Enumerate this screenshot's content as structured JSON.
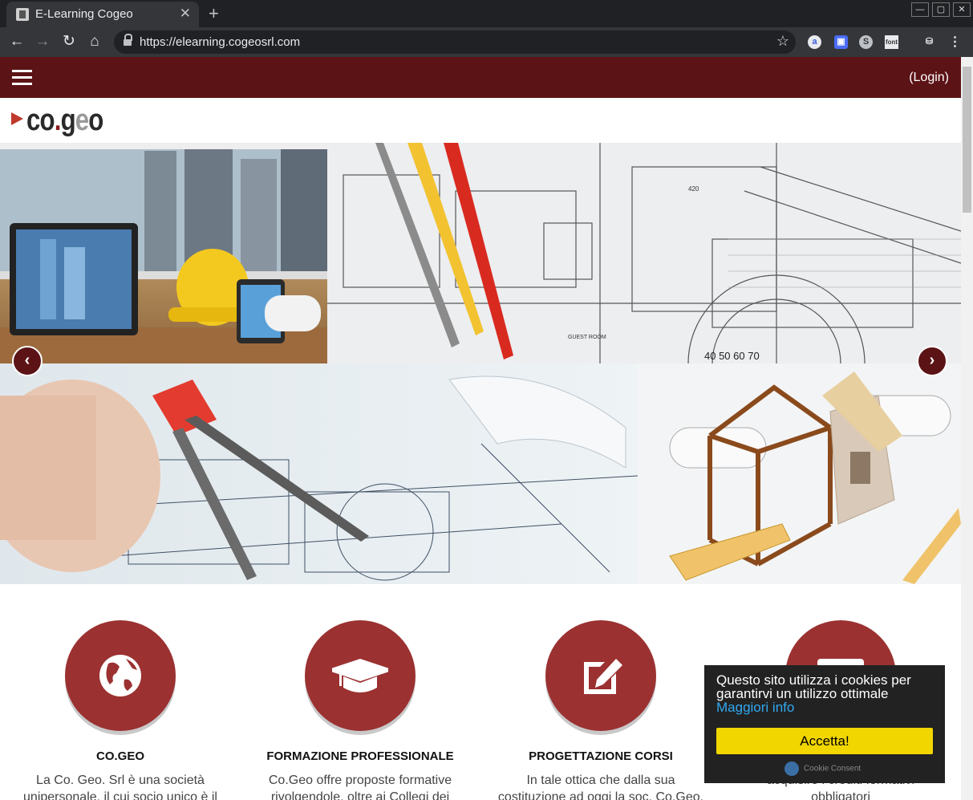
{
  "browser": {
    "tab_title": "E-Learning Cogeo",
    "tab_close": "✕",
    "new_tab": "+",
    "url": "https://elearning.cogeosrl.com",
    "window_controls": [
      "—",
      "▢",
      "✕"
    ]
  },
  "navbar": {
    "login_label": "(Login)"
  },
  "logo": {
    "text_co": "co",
    "text_dot": ".",
    "text_g": "g",
    "text_e": "e",
    "text_o": "o"
  },
  "carousel": {
    "prev_label": "‹",
    "next_label": "›"
  },
  "features": [
    {
      "icon": "globe-icon",
      "title": "CO.GEO",
      "text": "La Co. Geo. Srl è una società unipersonale, il cui socio unico è il"
    },
    {
      "icon": "graduation-cap-icon",
      "title": "FORMAZIONE PROFESSIONALE",
      "text": "Co.Geo offre proposte formative rivolgendole, oltre ai Collegi dei"
    },
    {
      "icon": "edit-icon",
      "title": "PROGETTAZIONE CORSI",
      "text": "In tale ottica che dalla sua costituzione ad oggi la soc. Co.Geo."
    },
    {
      "icon": "id-card-icon",
      "title": "",
      "text": "acquisire i crediti formativi obbligatori"
    }
  ],
  "cookie": {
    "message": "Questo sito utilizza i cookies per garantirvi un utilizzo ottimale",
    "link": "Maggiori info",
    "accept": "Accetta!",
    "brand": "Cookie Consent"
  },
  "colors": {
    "brand_dark": "#5c1316",
    "brand_circle": "#9b3131",
    "accept_yellow": "#f1d600"
  }
}
